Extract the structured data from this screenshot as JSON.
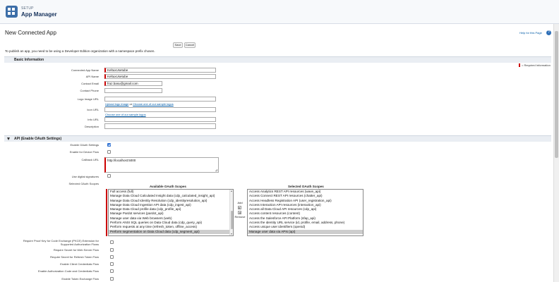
{
  "header": {
    "setup_label": "SETUP",
    "app_title": "App Manager",
    "icon": "grid-icon"
  },
  "page": {
    "title": "New Connected App",
    "help_link": "Help for this Page",
    "help_icon": "question-icon",
    "save_label": "Save",
    "cancel_label": "Cancel",
    "note": "To publish an app, you need to be using a Developer Edition organization with a namespace prefix chosen."
  },
  "basic_info": {
    "section_title": "Basic Information",
    "required_legend": "= Required Information",
    "fields": [
      {
        "label": "Connected App Name",
        "value": "KeltuxUsetube",
        "required": true
      },
      {
        "label": "API Name",
        "value": "KeltuxUsetube",
        "required": true
      },
      {
        "label": "Contact Email",
        "value": "fraz.basu@gmail.com",
        "required": true
      },
      {
        "label": "Contact Phone",
        "value": "",
        "required": false
      },
      {
        "label": "Logo Image URL",
        "value": "",
        "required": false
      },
      {
        "label": "Icon URL",
        "value": "",
        "required": false
      },
      {
        "label": "Info URL",
        "value": "",
        "required": false
      },
      {
        "label": "Description",
        "value": "",
        "required": false
      }
    ],
    "logo_upload_text": "Upload logo image",
    "logo_or": " or ",
    "logo_sample_text": "Choose one of our sample logos",
    "icon_sample_text": "Choose one of our sample logos"
  },
  "api": {
    "section_title": "API (Enable OAuth Settings)",
    "enable_oauth_label": "Enable OAuth Settings",
    "enable_oauth_checked": true,
    "device_flow_label": "Enable for Device Flow",
    "callback_label": "Callback URL",
    "callback_value": "http://localhost:5000",
    "digital_sig_label": "Use digital signatures",
    "scopes_label": "Selected OAuth Scopes",
    "available_head": "Available OAuth Scopes",
    "selected_head": "Selected OAuth Scopes",
    "add_label": "Add",
    "remove_label": "Remove",
    "available_scopes": [
      "Full access (full)",
      "Manage Data Cloud Calculated Insight data (cdp_calculated_insight_api)",
      "Manage Data Cloud Identity Resolution (cdp_identityresolution_api)",
      "Manage Data Cloud Ingestion API data (cdp_ingest_api)",
      "Manage Data Cloud profile data (cdp_profile_api)",
      "Manage Pardot services (pardot_api)",
      "Manage user data via Web browsers (web)",
      "Perform ANSI SQL queries on Data Cloud data (cdp_query_api)",
      "Perform requests at any time (refresh_token, offline_access)",
      "Perform segmentation on Data Cloud data (cdp_segment_api)"
    ],
    "selected_scopes": [
      "Access Analytics REST API resources (wave_api)",
      "Access Connect REST API resources (chatter_api)",
      "Access Headless Registration API (user_registration_api)",
      "Access Interaction API resources (interaction_api)",
      "Access all Data Cloud API resources (cdp_api)",
      "Access content resources (content)",
      "Access the Salesforce API Platform (sfap_api)",
      "Access the identity URL service (id, profile, email, address, phone)",
      "Access unique user identifiers (openid)",
      "Manage user data via APIs (api)"
    ],
    "pkce_label_1": "Require Proof Key for Code Exchange (PKCE) Extension for",
    "pkce_label_2": "Supported Authorization Flows",
    "secret_web_label": "Require Secret for Web Server Flow",
    "secret_refresh_label": "Require Secret for Refresh Token Flow",
    "client_cred_label": "Enable Client Credentials Flow",
    "auth_code_label": "Enable Authorization Code and Credentials Flow",
    "token_exchange_label": "Enable Token Exchange Flow"
  }
}
